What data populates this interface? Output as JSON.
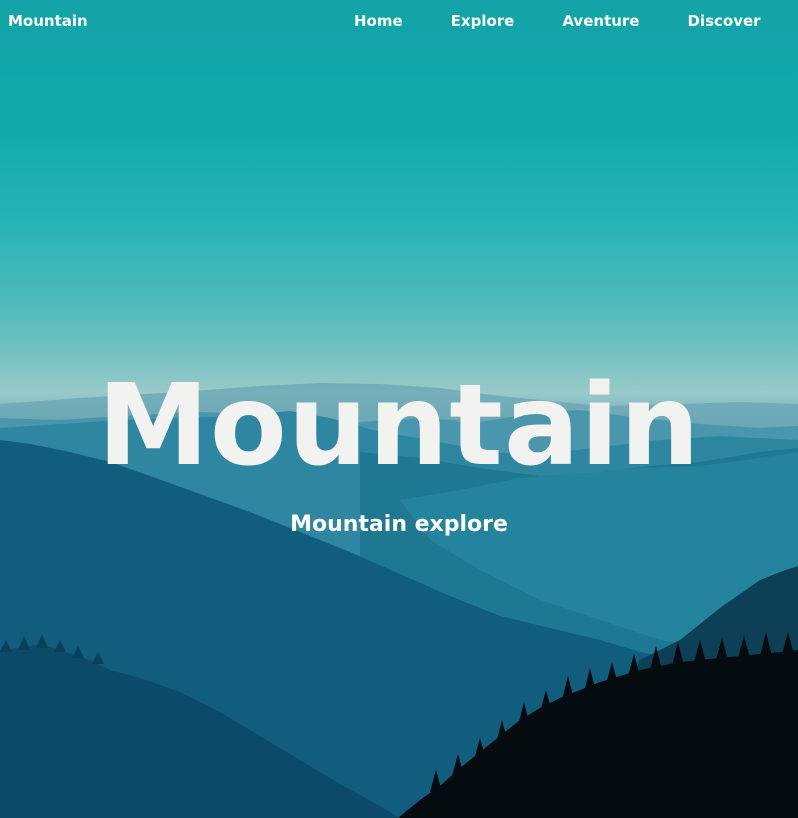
{
  "nav": {
    "brand": "Mountain",
    "links": [
      {
        "label": "Home"
      },
      {
        "label": "Explore"
      },
      {
        "label": "Aventure"
      },
      {
        "label": "Discover"
      }
    ]
  },
  "hero": {
    "title": "Mountain",
    "subtitle": "Mountain explore",
    "background_image": "misty teal mountain ridges with dark pine forest"
  },
  "colors": {
    "sky_top": "#13a3a8",
    "haze": "#98cac9",
    "ridge_mid": "#1b6f8a",
    "ridge_dark": "#0a4a66",
    "forest": "#050a0c",
    "text": "#ffffff"
  }
}
